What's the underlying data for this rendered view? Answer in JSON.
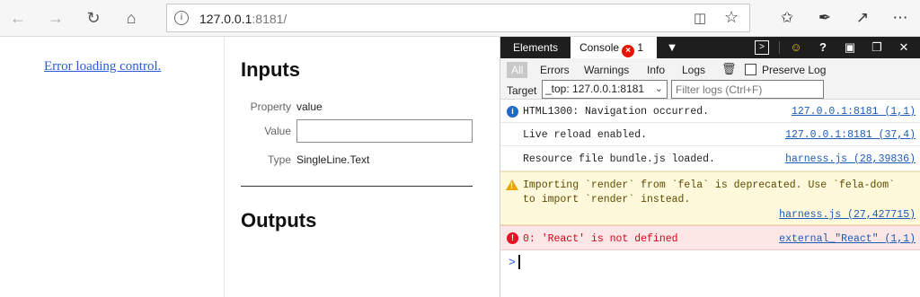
{
  "browser": {
    "url_host": "127.0.0.1",
    "url_rest": ":8181/",
    "icons": {
      "back": "back-arrow-icon",
      "forward": "forward-arrow-icon",
      "refresh": "refresh-icon",
      "home": "home-icon",
      "info": "info-icon",
      "reading": "reading-view-icon",
      "favorite": "star-icon",
      "favorites": "favorites-icon",
      "notes": "pen-icon",
      "share": "share-icon",
      "more": "more-icon"
    }
  },
  "page": {
    "error_link": "Error loading control.",
    "inputs_heading": "Inputs",
    "outputs_heading": "Outputs",
    "property_label": "Property",
    "property_value": "value",
    "value_label": "Value",
    "value_input": "",
    "type_label": "Type",
    "type_value": "SingleLine.Text"
  },
  "devtools": {
    "tabs": [
      {
        "label": "Elements"
      },
      {
        "label": "Console",
        "error_count": "1"
      }
    ],
    "filters": [
      "All",
      "Errors",
      "Warnings",
      "Info",
      "Logs"
    ],
    "preserve_log": "Preserve Log",
    "target_label": "Target",
    "target_value": "_top: 127.0.0.1:8181",
    "filter_placeholder": "Filter logs (Ctrl+F)",
    "messages": [
      {
        "level": "info",
        "text": "HTML1300: Navigation occurred.",
        "source": "127.0.0.1:8181 (1,1)"
      },
      {
        "level": "log",
        "text": "Live reload enabled.",
        "source": "127.0.0.1:8181 (37,4)"
      },
      {
        "level": "log",
        "text": "Resource file bundle.js loaded.",
        "source": "harness.js (28,39836)"
      },
      {
        "level": "warning",
        "text_line1": "Importing `render` from `fela` is deprecated. Use `fela-dom`",
        "text_line2": "to import `render` instead.",
        "source": "harness.js (27,427715)"
      },
      {
        "level": "error",
        "text": "0: 'React' is not defined",
        "source": "external_\"React\" (1,1)"
      }
    ],
    "prompt": ">"
  },
  "colors": {
    "link": "#2b5bd6",
    "devtools_bar": "#1e1e1e",
    "error": "#e81123",
    "warning_bg": "#fff9dc",
    "error_bg": "#fde6e6"
  }
}
